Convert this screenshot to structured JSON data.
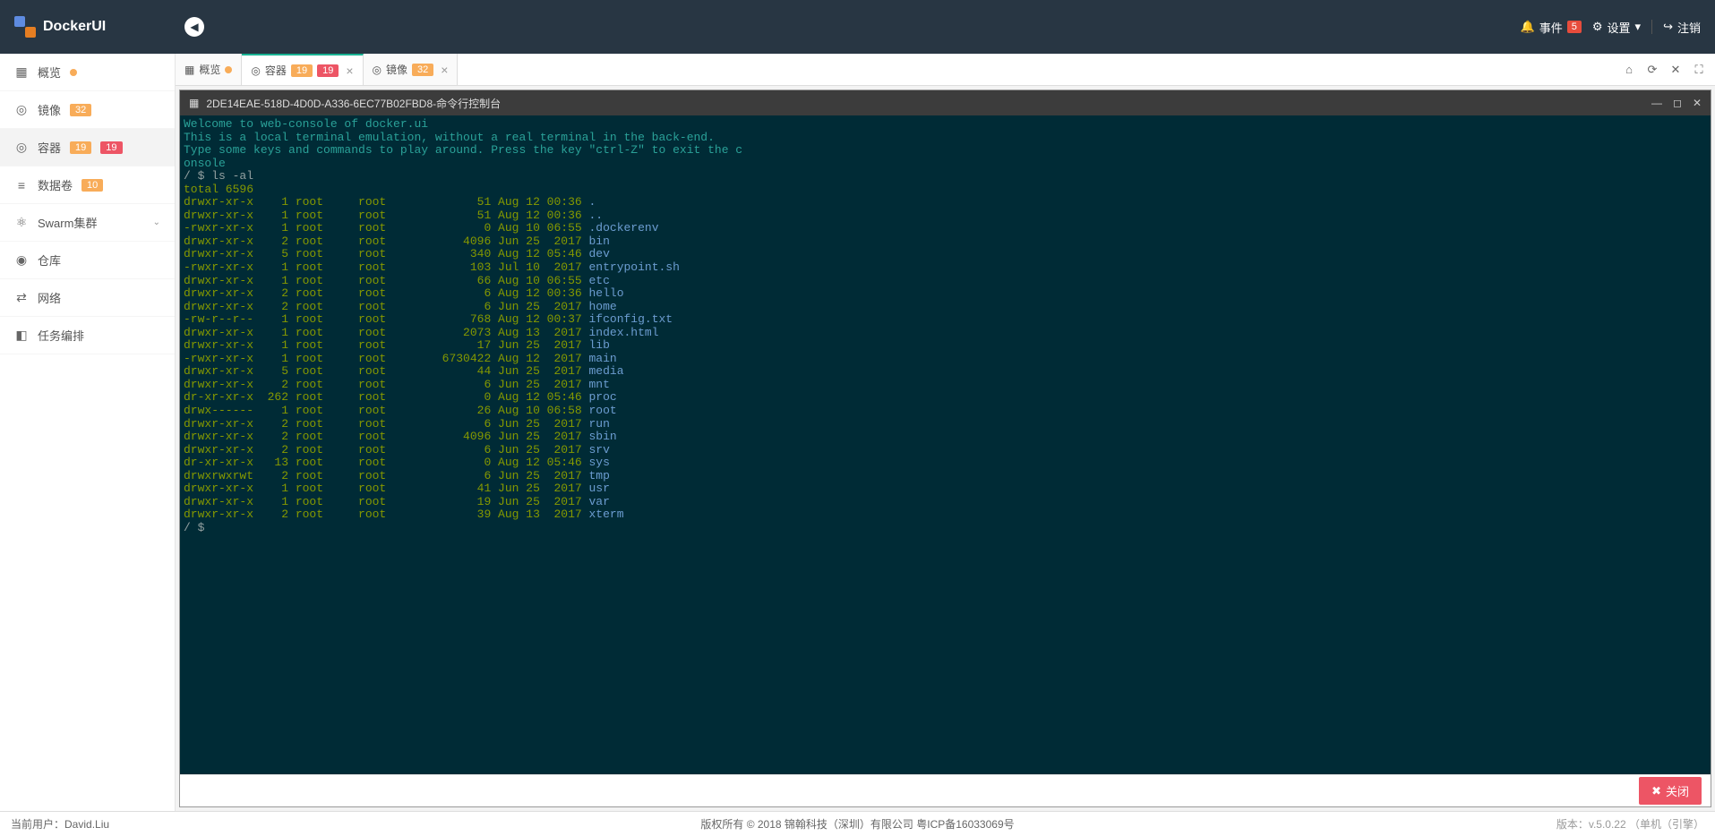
{
  "app": {
    "name": "DockerUI"
  },
  "header": {
    "events_label": "事件",
    "events_count": "5",
    "settings_label": "设置",
    "logout_label": "注销"
  },
  "sidebar": {
    "items": [
      {
        "icon": "▦",
        "label": "概览",
        "has_dot": true
      },
      {
        "icon": "◎",
        "label": "镜像",
        "badges": [
          {
            "type": "o",
            "text": "32"
          }
        ]
      },
      {
        "icon": "◎",
        "label": "容器",
        "badges": [
          {
            "type": "o",
            "text": "19"
          },
          {
            "type": "r",
            "text": "19"
          }
        ],
        "active": true
      },
      {
        "icon": "≡",
        "label": "数据卷",
        "badges": [
          {
            "type": "o",
            "text": "10"
          }
        ]
      },
      {
        "icon": "⚛",
        "label": "Swarm集群",
        "expand": true
      },
      {
        "icon": "◉",
        "label": "仓库"
      },
      {
        "icon": "⇄",
        "label": "网络"
      },
      {
        "icon": "◧",
        "label": "任务编排"
      }
    ]
  },
  "tabs": {
    "items": [
      {
        "icon": "▦",
        "label": "概览",
        "has_dot": true
      },
      {
        "icon": "◎",
        "label": "容器",
        "badges": [
          {
            "type": "o",
            "text": "19"
          },
          {
            "type": "r",
            "text": "19"
          }
        ],
        "active": true,
        "closable": true
      },
      {
        "icon": "◎",
        "label": "镜像",
        "badges": [
          {
            "type": "o",
            "text": "32"
          }
        ],
        "closable": true
      }
    ]
  },
  "terminal": {
    "title": "2DE14EAE-518D-4D0D-A336-6EC77B02FBD8-命令行控制台",
    "intro": [
      "Welcome to web-console of docker.ui",
      "This is a local terminal emulation, without a real terminal in the back-end.",
      "Type some keys and commands to play around. Press the key \"ctrl-Z\" to exit the c",
      "onsole"
    ],
    "prompt1": "/ $ ",
    "command": "ls -al",
    "total": "total 6596",
    "rows": [
      {
        "perm": "drwxr-xr-x",
        "n": "1",
        "u": "root",
        "g": "root",
        "sz": "51",
        "date": "Aug 12 00:36",
        "name": "."
      },
      {
        "perm": "drwxr-xr-x",
        "n": "1",
        "u": "root",
        "g": "root",
        "sz": "51",
        "date": "Aug 12 00:36",
        "name": ".."
      },
      {
        "perm": "-rwxr-xr-x",
        "n": "1",
        "u": "root",
        "g": "root",
        "sz": "0",
        "date": "Aug 10 06:55",
        "name": ".dockerenv"
      },
      {
        "perm": "drwxr-xr-x",
        "n": "2",
        "u": "root",
        "g": "root",
        "sz": "4096",
        "date": "Jun 25  2017",
        "name": "bin"
      },
      {
        "perm": "drwxr-xr-x",
        "n": "5",
        "u": "root",
        "g": "root",
        "sz": "340",
        "date": "Aug 12 05:46",
        "name": "dev"
      },
      {
        "perm": "-rwxr-xr-x",
        "n": "1",
        "u": "root",
        "g": "root",
        "sz": "103",
        "date": "Jul 10  2017",
        "name": "entrypoint.sh"
      },
      {
        "perm": "drwxr-xr-x",
        "n": "1",
        "u": "root",
        "g": "root",
        "sz": "66",
        "date": "Aug 10 06:55",
        "name": "etc"
      },
      {
        "perm": "drwxr-xr-x",
        "n": "2",
        "u": "root",
        "g": "root",
        "sz": "6",
        "date": "Aug 12 00:36",
        "name": "hello"
      },
      {
        "perm": "drwxr-xr-x",
        "n": "2",
        "u": "root",
        "g": "root",
        "sz": "6",
        "date": "Jun 25  2017",
        "name": "home"
      },
      {
        "perm": "-rw-r--r--",
        "n": "1",
        "u": "root",
        "g": "root",
        "sz": "768",
        "date": "Aug 12 00:37",
        "name": "ifconfig.txt"
      },
      {
        "perm": "drwxr-xr-x",
        "n": "1",
        "u": "root",
        "g": "root",
        "sz": "2073",
        "date": "Aug 13  2017",
        "name": "index.html"
      },
      {
        "perm": "drwxr-xr-x",
        "n": "1",
        "u": "root",
        "g": "root",
        "sz": "17",
        "date": "Jun 25  2017",
        "name": "lib"
      },
      {
        "perm": "-rwxr-xr-x",
        "n": "1",
        "u": "root",
        "g": "root",
        "sz": "6730422",
        "date": "Aug 12  2017",
        "name": "main"
      },
      {
        "perm": "drwxr-xr-x",
        "n": "5",
        "u": "root",
        "g": "root",
        "sz": "44",
        "date": "Jun 25  2017",
        "name": "media"
      },
      {
        "perm": "drwxr-xr-x",
        "n": "2",
        "u": "root",
        "g": "root",
        "sz": "6",
        "date": "Jun 25  2017",
        "name": "mnt"
      },
      {
        "perm": "dr-xr-xr-x",
        "n": "262",
        "u": "root",
        "g": "root",
        "sz": "0",
        "date": "Aug 12 05:46",
        "name": "proc"
      },
      {
        "perm": "drwx------",
        "n": "1",
        "u": "root",
        "g": "root",
        "sz": "26",
        "date": "Aug 10 06:58",
        "name": "root"
      },
      {
        "perm": "drwxr-xr-x",
        "n": "2",
        "u": "root",
        "g": "root",
        "sz": "6",
        "date": "Jun 25  2017",
        "name": "run"
      },
      {
        "perm": "drwxr-xr-x",
        "n": "2",
        "u": "root",
        "g": "root",
        "sz": "4096",
        "date": "Jun 25  2017",
        "name": "sbin"
      },
      {
        "perm": "drwxr-xr-x",
        "n": "2",
        "u": "root",
        "g": "root",
        "sz": "6",
        "date": "Jun 25  2017",
        "name": "srv"
      },
      {
        "perm": "dr-xr-xr-x",
        "n": "13",
        "u": "root",
        "g": "root",
        "sz": "0",
        "date": "Aug 12 05:46",
        "name": "sys"
      },
      {
        "perm": "drwxrwxrwt",
        "n": "2",
        "u": "root",
        "g": "root",
        "sz": "6",
        "date": "Jun 25  2017",
        "name": "tmp"
      },
      {
        "perm": "drwxr-xr-x",
        "n": "1",
        "u": "root",
        "g": "root",
        "sz": "41",
        "date": "Jun 25  2017",
        "name": "usr"
      },
      {
        "perm": "drwxr-xr-x",
        "n": "1",
        "u": "root",
        "g": "root",
        "sz": "19",
        "date": "Jun 25  2017",
        "name": "var"
      },
      {
        "perm": "drwxr-xr-x",
        "n": "2",
        "u": "root",
        "g": "root",
        "sz": "39",
        "date": "Aug 13  2017",
        "name": "xterm"
      }
    ],
    "prompt_end": "/ $",
    "close_btn": "关闭"
  },
  "footer": {
    "user_label": "当前用户：",
    "user": "David.Liu",
    "copyright": "版权所有 © 2018 锦翰科技（深圳）有限公司 粤ICP备16033069号",
    "version_label": "版本：",
    "version": "v.5.0.22 （单机（引擎）"
  }
}
